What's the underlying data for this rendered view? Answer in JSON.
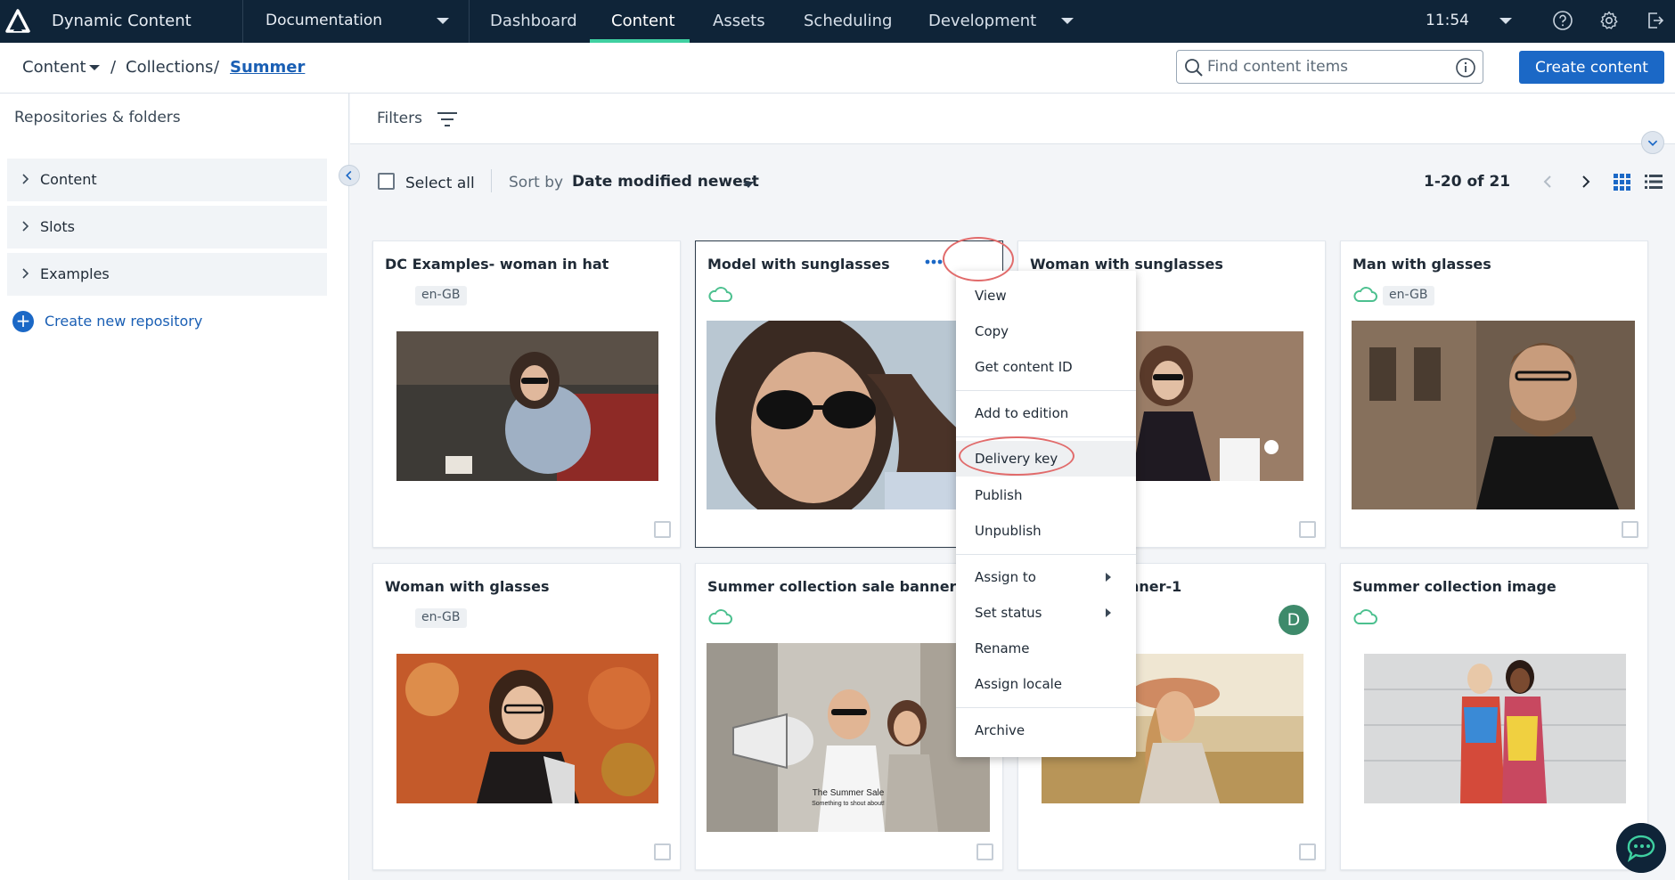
{
  "topbar": {
    "app_title": "Dynamic Content",
    "hub": "Documentation",
    "tabs": [
      "Dashboard",
      "Content",
      "Assets",
      "Scheduling",
      "Development"
    ],
    "active_tab": "Content",
    "clock": "11:54",
    "accent_color": "#3fd0a1",
    "icons": [
      "amplience-logo-icon",
      "help-icon",
      "gear-icon",
      "sign-out-icon"
    ]
  },
  "breadcrumb": {
    "root": "Content",
    "sep": "/",
    "collections": "Collections",
    "current": "Summer"
  },
  "search": {
    "placeholder": "Find content items"
  },
  "create_content": "Create content",
  "sidebar": {
    "heading": "Repositories & folders",
    "repos": [
      "Content",
      "Slots",
      "Examples"
    ],
    "create_repo": "Create new repository"
  },
  "filters": {
    "label": "Filters"
  },
  "toolbar": {
    "select_all": "Select all",
    "sort_by": "Sort by",
    "sort_value": "Date modified newest",
    "pager": "1-20 of 21"
  },
  "cards": [
    {
      "title": "DC Examples- woman in hat",
      "locale": "en-GB",
      "cloud": false
    },
    {
      "title": "Model with sunglasses",
      "locale": "",
      "cloud": true
    },
    {
      "title": "Woman with sunglasses",
      "locale": "",
      "cloud": false
    },
    {
      "title": "Man with glasses",
      "locale": "en-GB",
      "cloud": true
    },
    {
      "title": "Woman with glasses",
      "locale": "en-GB",
      "cloud": false
    },
    {
      "title": "Summer collection sale banner",
      "locale": "",
      "cloud": true,
      "caption": "The Summer Sale",
      "subcaption": "Something to shout about!"
    },
    {
      "title": "nner-1",
      "locale": "",
      "cloud": false,
      "avatar": "D"
    },
    {
      "title": "Summer collection image",
      "locale": "",
      "cloud": true
    }
  ],
  "context_menu": {
    "items": [
      "View",
      "Copy",
      "Get content ID",
      "Add to edition",
      "Delivery key",
      "Publish",
      "Unpublish",
      "Assign to",
      "Set status",
      "Rename",
      "Assign locale",
      "Archive"
    ],
    "highlighted": "Delivery key"
  },
  "colors": {
    "nav_bg": "#0f2438",
    "primary_button": "#1b68c6",
    "cloud_green": "#4cc08f",
    "annotation_red": "#e16b6b"
  }
}
